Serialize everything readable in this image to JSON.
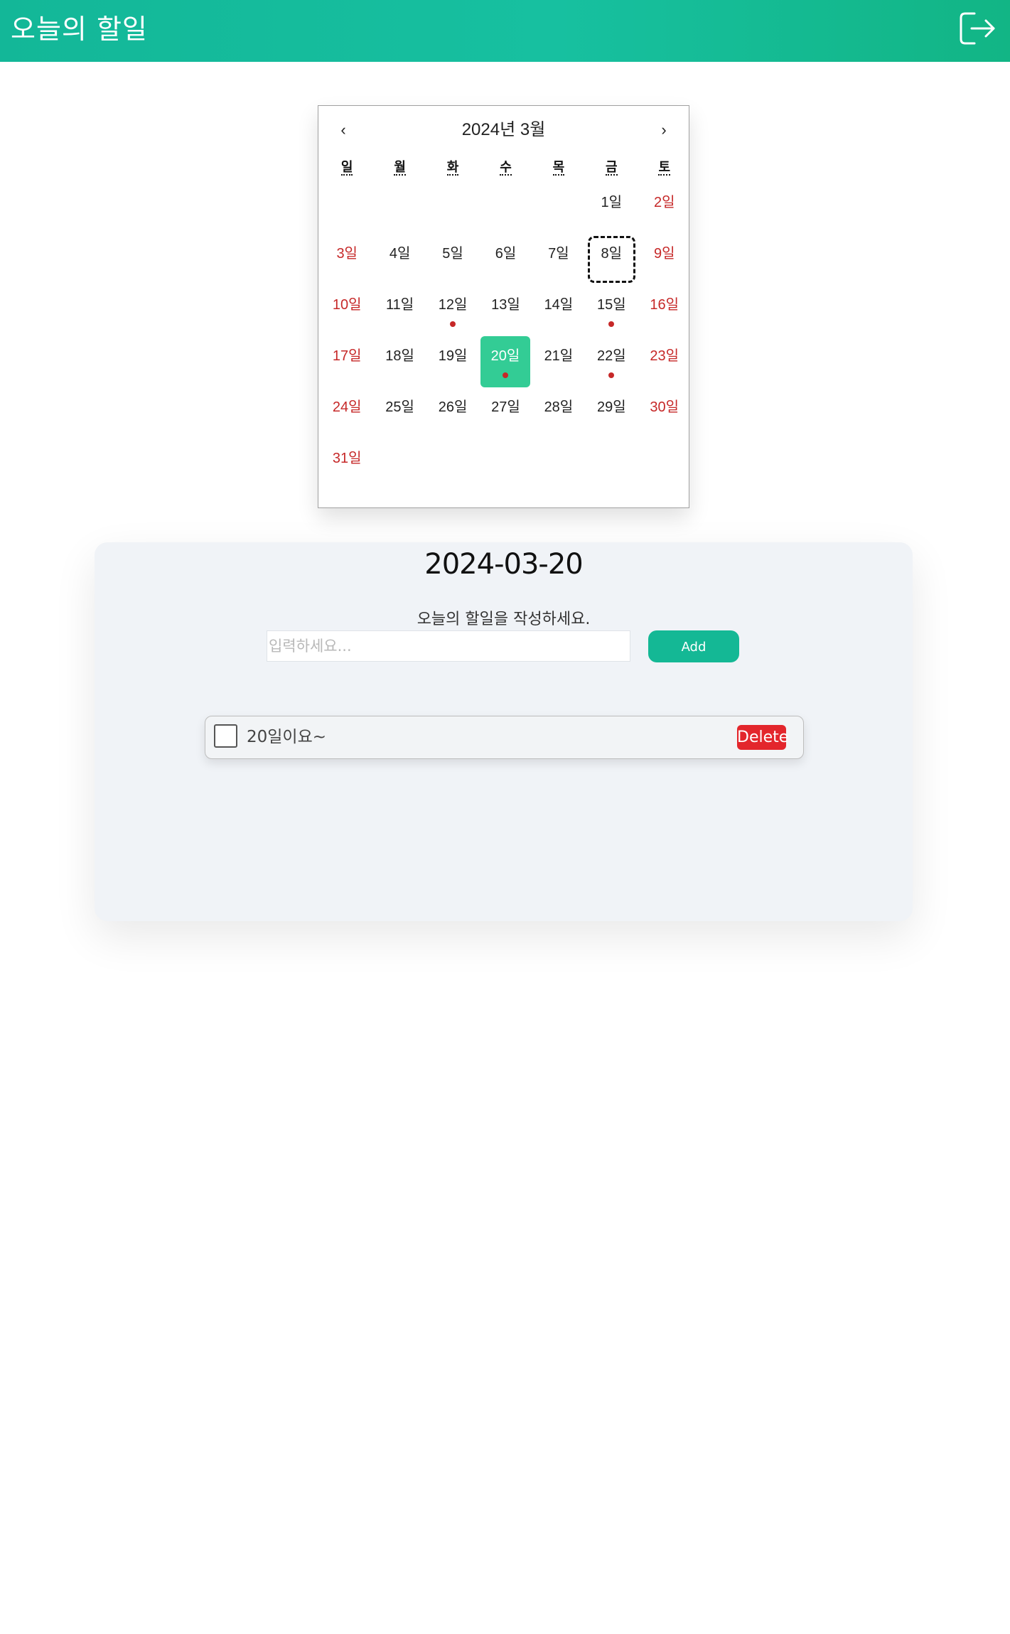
{
  "header": {
    "title": "오늘의 할일",
    "logout_icon": "logout-icon"
  },
  "calendar": {
    "prev_label": "‹",
    "next_label": "›",
    "month_label": "2024년 3월",
    "weekdays": [
      "일",
      "월",
      "화",
      "수",
      "목",
      "금",
      "토"
    ],
    "leading_blanks": 5,
    "days": [
      {
        "label": "1일",
        "weekend": false,
        "dot": false
      },
      {
        "label": "2일",
        "weekend": true,
        "dot": false
      },
      {
        "label": "3일",
        "weekend": true,
        "dot": false
      },
      {
        "label": "4일",
        "weekend": false,
        "dot": false
      },
      {
        "label": "5일",
        "weekend": false,
        "dot": false
      },
      {
        "label": "6일",
        "weekend": false,
        "dot": false
      },
      {
        "label": "7일",
        "weekend": false,
        "dot": false
      },
      {
        "label": "8일",
        "weekend": false,
        "dot": false,
        "today": true
      },
      {
        "label": "9일",
        "weekend": true,
        "dot": false
      },
      {
        "label": "10일",
        "weekend": true,
        "dot": false
      },
      {
        "label": "11일",
        "weekend": false,
        "dot": false
      },
      {
        "label": "12일",
        "weekend": false,
        "dot": true
      },
      {
        "label": "13일",
        "weekend": false,
        "dot": false
      },
      {
        "label": "14일",
        "weekend": false,
        "dot": false
      },
      {
        "label": "15일",
        "weekend": false,
        "dot": true
      },
      {
        "label": "16일",
        "weekend": true,
        "dot": false
      },
      {
        "label": "17일",
        "weekend": true,
        "dot": false
      },
      {
        "label": "18일",
        "weekend": false,
        "dot": false
      },
      {
        "label": "19일",
        "weekend": false,
        "dot": false
      },
      {
        "label": "20일",
        "weekend": false,
        "dot": true,
        "selected": true
      },
      {
        "label": "21일",
        "weekend": false,
        "dot": false
      },
      {
        "label": "22일",
        "weekend": false,
        "dot": true
      },
      {
        "label": "23일",
        "weekend": true,
        "dot": false
      },
      {
        "label": "24일",
        "weekend": true,
        "dot": false
      },
      {
        "label": "25일",
        "weekend": false,
        "dot": false
      },
      {
        "label": "26일",
        "weekend": false,
        "dot": false
      },
      {
        "label": "27일",
        "weekend": false,
        "dot": false
      },
      {
        "label": "28일",
        "weekend": false,
        "dot": false
      },
      {
        "label": "29일",
        "weekend": false,
        "dot": false
      },
      {
        "label": "30일",
        "weekend": true,
        "dot": false
      },
      {
        "label": "31일",
        "weekend": true,
        "dot": false
      }
    ],
    "colors": {
      "selected": "#33cc95",
      "weekend": "#c62828",
      "dot": "#c62828"
    }
  },
  "panel": {
    "date": "2024-03-20",
    "prompt": "오늘의 할일을 작성하세요.",
    "input_value": "",
    "input_placeholder": "입력하세요...",
    "add_label": "Add",
    "todos": [
      {
        "text": "20일이요~",
        "checked": false,
        "delete_label": "Delete"
      }
    ]
  },
  "colors": {
    "accent": "#14b895",
    "danger": "#e3262c"
  }
}
